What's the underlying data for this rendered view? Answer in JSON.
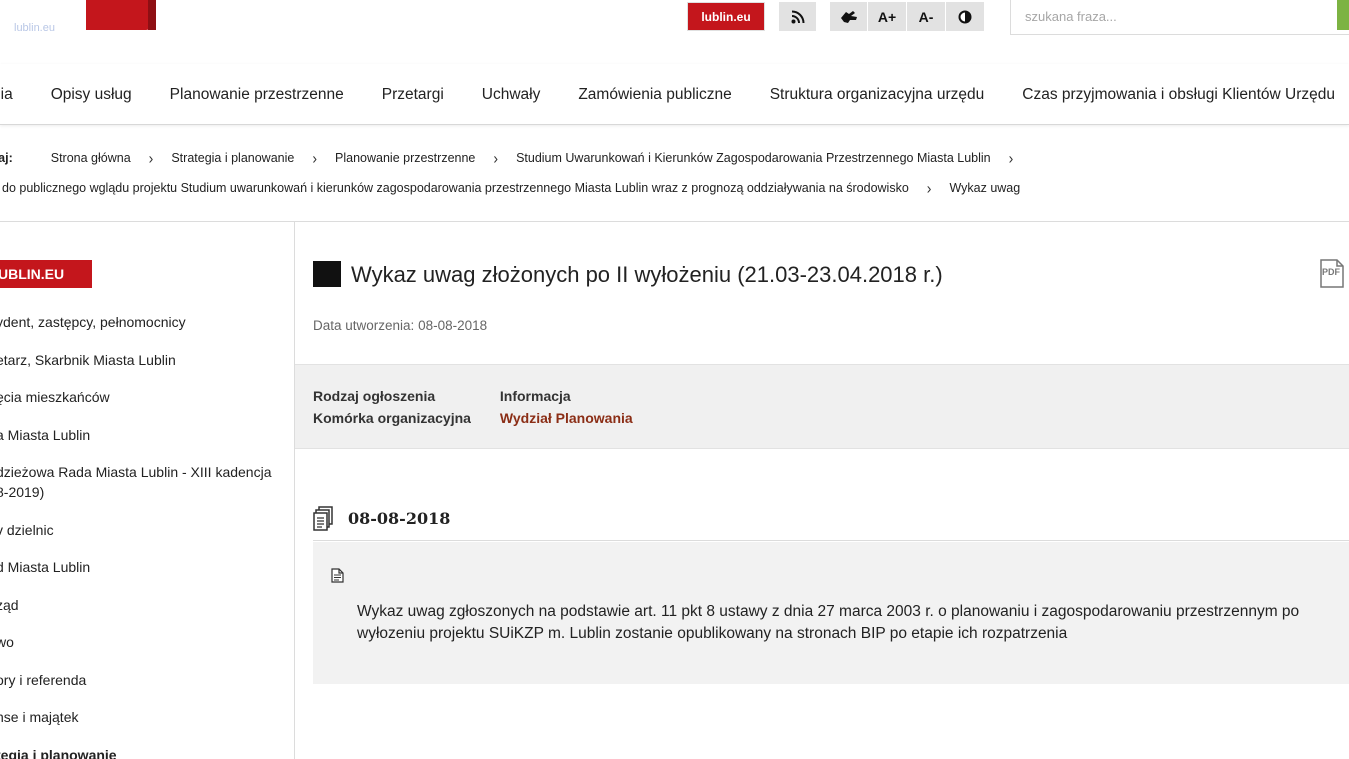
{
  "header": {
    "portal_button": "lublin.eu",
    "font_increase": "A+",
    "font_decrease": "A-",
    "search_placeholder": "szukana fraza...",
    "ghost_logo": "lublin.eu"
  },
  "icons": [
    "rss-icon",
    "sign-language-icon",
    "contrast-icon",
    "pdf-icon",
    "attachments-icon",
    "document-icon",
    "chevron-right-icon"
  ],
  "nav": {
    "items": [
      "nia",
      "Opisy usług",
      "Planowanie przestrzenne",
      "Przetargi",
      "Uchwały",
      "Zamówienia publiczne",
      "Struktura organizacyjna urzędu",
      "Czas przyjmowania i obsługi Klientów Urzędu"
    ]
  },
  "breadcrumb": {
    "label": "taj:",
    "row1": [
      "Strona główna",
      "Strategia i planowanie",
      "Planowanie przestrzenne",
      "Studium Uwarunkowań i Kierunków Zagospodarowania Przestrzennego Miasta Lublin"
    ],
    "row2": [
      "do publicznego wglądu projektu Studium uwarunkowań i kierunków zagospodarowania przestrzennego Miasta Lublin wraz z prognozą oddziaływania na środowisko",
      "Wykaz uwag"
    ]
  },
  "sidebar": {
    "brand": "UBLIN.EU",
    "items": [
      "ydent, zastępcy, pełnomocnicy",
      "etarz, Skarbnik Miasta Lublin",
      "ęcia mieszkańców",
      "a Miasta Lublin",
      "dzieżowa Rada Miasta Lublin - XIII kadencja\n8-2019)",
      "v dzielnic",
      "d Miasta Lublin",
      "ząd",
      "wo",
      "ory i referenda",
      "nse i majątek",
      "tegia i planowanie"
    ]
  },
  "content": {
    "title": "Wykaz uwag złożonych po II wyłożeniu (21.03-23.04.2018 r.)",
    "created_label": "Data utworzenia:",
    "created_value": "08-08-2018",
    "meta": {
      "type_label": "Rodzaj ogłoszenia",
      "type_value": "Informacja",
      "unit_label": "Komórka organizacyjna",
      "unit_value": "Wydział Planowania"
    },
    "attachment_date": "08-08-2018",
    "attachment_text": "Wykaz uwag zgłoszonych na podstawie art. 11 pkt 8 ustawy z dnia 27 marca 2003 r. o planowaniu i zagospodarowaniu przestrzennym po wyłozeniu projektu SUiKZP m. Lublin zostanie opublikowany na stronach BIP po etapie ich rozpatrzenia"
  },
  "colors": {
    "brand_red": "#c4161c",
    "search_green": "#7cb342",
    "link_brown": "#8b2e16"
  }
}
